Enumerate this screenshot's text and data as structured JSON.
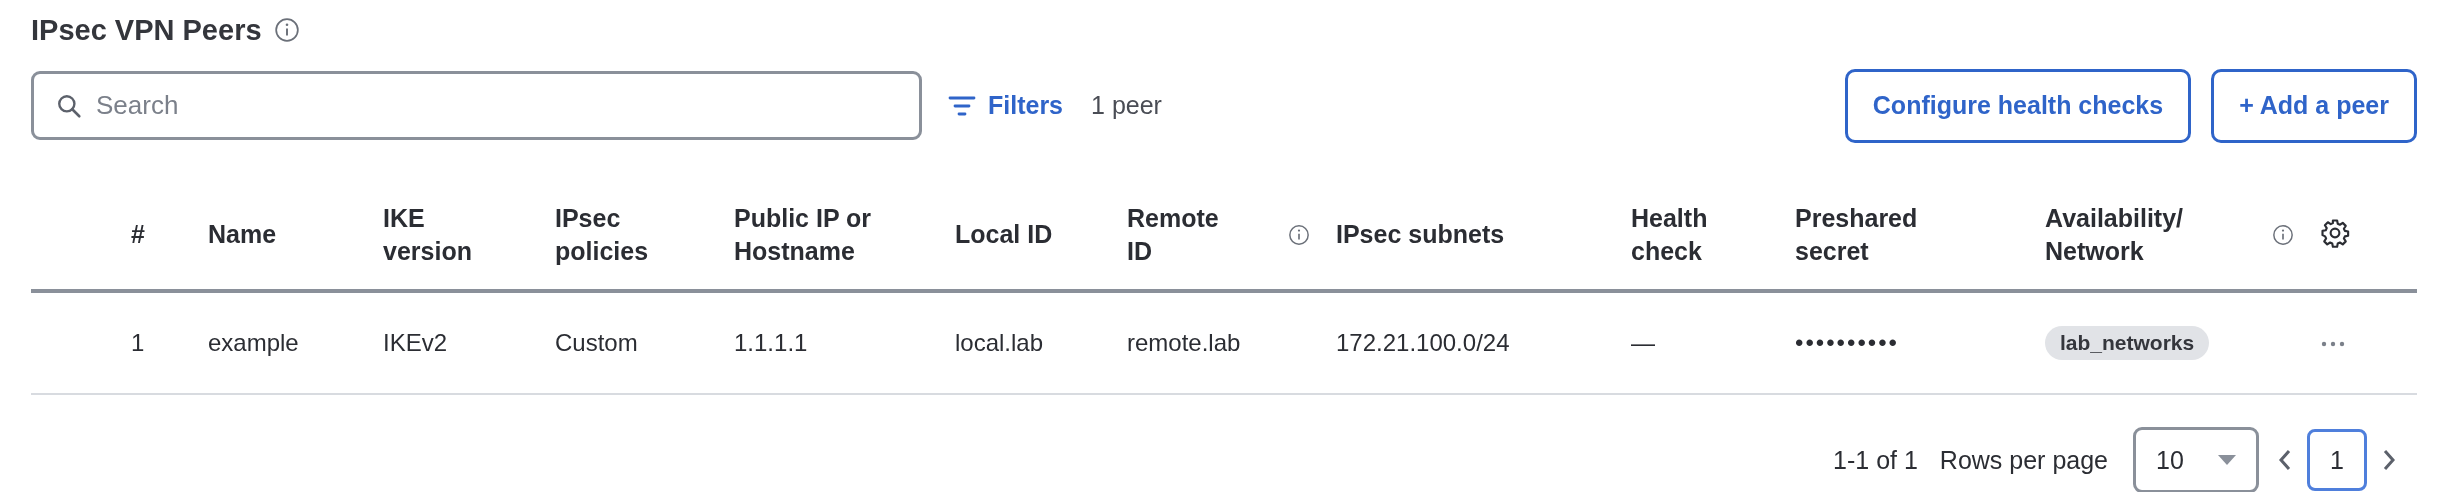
{
  "header": {
    "title": "IPsec VPN Peers"
  },
  "toolbar": {
    "search": {
      "placeholder": "Search"
    },
    "filters_label": "Filters",
    "count": "1 peer",
    "buttons": [
      {
        "label": "Configure health checks"
      },
      {
        "label": "+ Add a peer"
      }
    ]
  },
  "table": {
    "columns": [
      {
        "label": "#",
        "info": false
      },
      {
        "label": "Name",
        "info": false
      },
      {
        "label": "IKE version",
        "info": false
      },
      {
        "label": "IPsec policies",
        "info": false
      },
      {
        "label": "Public IP or Hostname",
        "info": false
      },
      {
        "label": "Local ID",
        "info": false
      },
      {
        "label": "Remote ID",
        "info": true
      },
      {
        "label": "IPsec subnets",
        "info": false
      },
      {
        "label": "Health check",
        "info": false
      },
      {
        "label": "Preshared secret",
        "info": false
      },
      {
        "label": "Availability/ Network",
        "info": true
      }
    ],
    "rows": [
      {
        "cells": [
          {
            "kind": "text",
            "text": "1"
          },
          {
            "kind": "text",
            "text": "example"
          },
          {
            "kind": "text",
            "text": "IKEv2"
          },
          {
            "kind": "text",
            "text": "Custom"
          },
          {
            "kind": "text",
            "text": "1.1.1.1"
          },
          {
            "kind": "text",
            "text": "local.lab"
          },
          {
            "kind": "text",
            "text": "remote.lab"
          },
          {
            "kind": "text",
            "text": "172.21.100.0/24"
          },
          {
            "kind": "text",
            "text": "—"
          },
          {
            "kind": "secret",
            "text": "••••••••••"
          },
          {
            "kind": "tag",
            "text": "lab_networks"
          }
        ]
      }
    ]
  },
  "pagination": {
    "range": "1-1 of 1",
    "rows_per_page_label": "Rows per page",
    "rows_per_page": "10",
    "pages": [
      {
        "label": "1",
        "selected": true
      }
    ]
  }
}
